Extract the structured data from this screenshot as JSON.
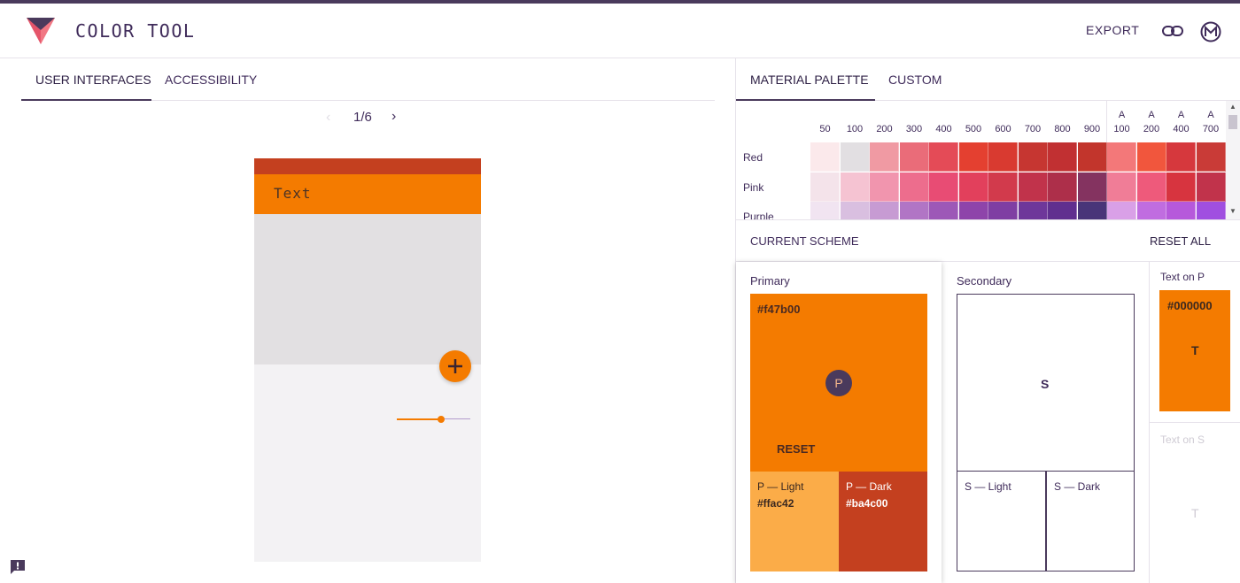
{
  "app": {
    "title": "COLOR TOOL",
    "export_label": "EXPORT"
  },
  "icons": {
    "logo": "color-tool-logo",
    "link": "link-icon",
    "brand": "material-icon",
    "feedback": "feedback-icon"
  },
  "left_tabs": [
    {
      "label": "USER INTERFACES",
      "active": true
    },
    {
      "label": "ACCESSIBILITY",
      "active": false
    }
  ],
  "pager": {
    "prev": "‹",
    "text": "1/6",
    "next": "›"
  },
  "preview": {
    "appbar_text": "Text",
    "slider_value": 0.6
  },
  "right_tabs": [
    {
      "label": "MATERIAL PALETTE",
      "active": true
    },
    {
      "label": "CUSTOM",
      "active": false
    }
  ],
  "palette": {
    "shades": [
      "50",
      "100",
      "200",
      "300",
      "400",
      "500",
      "600",
      "700",
      "800",
      "900"
    ],
    "accent_shades": [
      [
        "A",
        "100"
      ],
      [
        "A",
        "200"
      ],
      [
        "A",
        "400"
      ],
      [
        "A",
        "700"
      ]
    ],
    "rows": [
      {
        "name": "Red",
        "colors": [
          "#fbe9eb",
          "#e2dfe2",
          "#f09aa3",
          "#ea6c79",
          "#e44b57",
          "#e44030",
          "#d93a30",
          "#c63631",
          "#c13032",
          "#c2352c",
          "#f37879",
          "#f1563d",
          "#d6383d",
          "#c93b37"
        ]
      },
      {
        "name": "Pink",
        "colors": [
          "#f4e3ea",
          "#f5c3d2",
          "#f195ae",
          "#ed6d8d",
          "#e84c74",
          "#e2405c",
          "#d23a4c",
          "#c1334b",
          "#ad2f4a",
          "#843360",
          "#f07d97",
          "#ee5a7b",
          "#d7343f",
          "#c1334b"
        ]
      },
      {
        "name": "Purple",
        "colors": [
          "#f1e4f1",
          "#d9bfe0",
          "#c79bd3",
          "#b175c5",
          "#9d58b7",
          "#8e44aa",
          "#7f3ea3",
          "#6e379a",
          "#602f8f",
          "#493579",
          "#d9a0e7",
          "#c06de0",
          "#b659db",
          "#a04fe0"
        ]
      }
    ]
  },
  "scheme": {
    "title": "CURRENT SCHEME",
    "reset_all": "RESET ALL",
    "primary": {
      "label": "Primary",
      "hex": "#f47b00",
      "letter": "P",
      "reset": "RESET"
    },
    "primary_light": {
      "label": "P — Light",
      "hex": "#ffac42"
    },
    "primary_dark": {
      "label": "P — Dark",
      "hex": "#ba4c00"
    },
    "secondary": {
      "label": "Secondary",
      "letter": "S"
    },
    "secondary_light": {
      "label": "S — Light"
    },
    "secondary_dark": {
      "label": "S — Dark"
    },
    "text_on_p": {
      "label": "Text on P",
      "hex": "#000000",
      "letter": "T"
    },
    "text_on_s": {
      "label": "Text on S",
      "letter": "T"
    }
  },
  "colors": {
    "accent": "#4a3a5c",
    "primary": "#f47b00",
    "primary_light": "#fbac48",
    "primary_dark": "#c4401f"
  }
}
